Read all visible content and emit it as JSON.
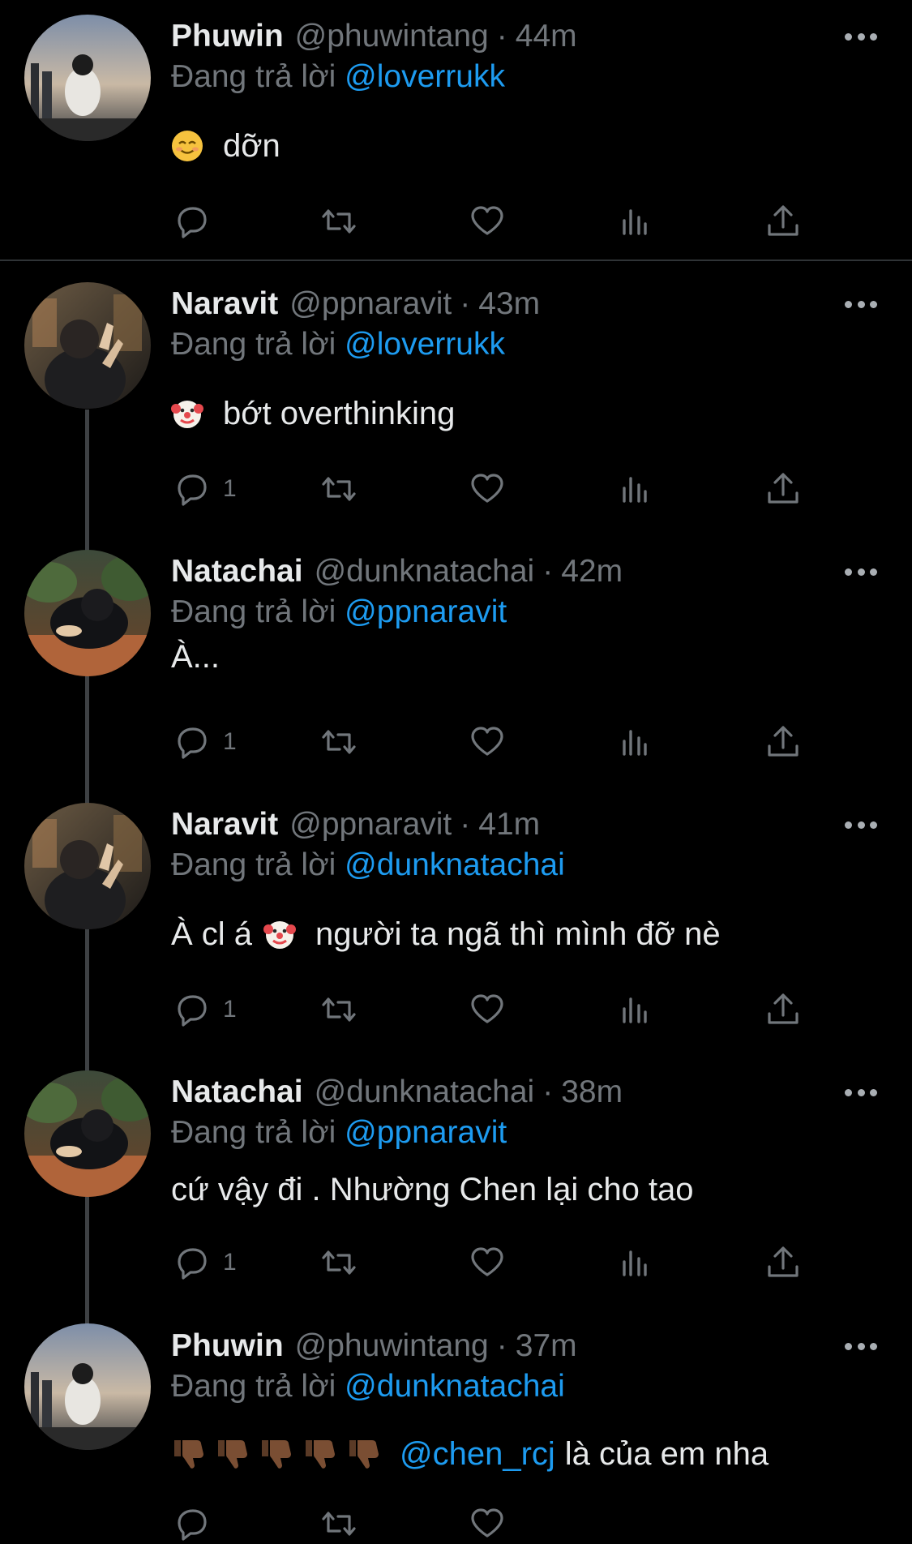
{
  "replying_prefix": "Đang trả lời",
  "tweets": [
    {
      "name": "Phuwin",
      "handle": "@phuwintang",
      "time": "44m",
      "reply_to": "@loverrukk",
      "emoji": "smiling-face",
      "text": "dỡn",
      "reply_count": ""
    },
    {
      "name": "Naravit",
      "handle": "@ppnaravit",
      "time": "43m",
      "reply_to": "@loverrukk",
      "emoji": "clown-face",
      "text": "bớt overthinking",
      "reply_count": "1"
    },
    {
      "name": "Natachai",
      "handle": "@dunknatachai",
      "time": "42m",
      "reply_to": "@ppnaravit",
      "text": "À...",
      "reply_count": "1"
    },
    {
      "name": "Naravit",
      "handle": "@ppnaravit",
      "time": "41m",
      "reply_to": "@dunknatachai",
      "text_before": "À cl á",
      "emoji": "clown-face",
      "text": "người ta ngã thì mình đỡ nè",
      "reply_count": "1"
    },
    {
      "name": "Natachai",
      "handle": "@dunknatachai",
      "time": "38m",
      "reply_to": "@ppnaravit",
      "text": "cứ vậy đi . Nhường Chen lại cho tao",
      "reply_count": "1"
    },
    {
      "name": "Phuwin",
      "handle": "@phuwintang",
      "time": "37m",
      "reply_to": "@dunknatachai",
      "emoji": "thumbs-down-x5",
      "mention": "@chen_rcj",
      "text": "là của em nha"
    }
  ],
  "colors": {
    "background": "#000000",
    "link": "#1d9bf0",
    "muted": "#71767b",
    "text": "#e7e9ea"
  }
}
